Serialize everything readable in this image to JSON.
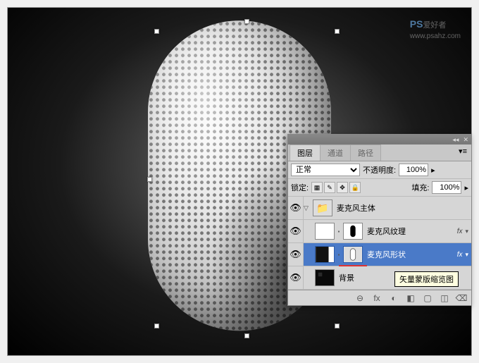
{
  "watermark": {
    "prefix": "PS",
    "suffix": "爱好者",
    "url": "www.psahz.com"
  },
  "panel": {
    "tabs": [
      {
        "label": "图层",
        "active": true
      },
      {
        "label": "通道",
        "active": false
      },
      {
        "label": "路径",
        "active": false
      }
    ],
    "blend": {
      "value": "正常"
    },
    "opacity": {
      "label": "不透明度:",
      "value": "100%"
    },
    "lock": {
      "label": "锁定:"
    },
    "fill": {
      "label": "填充:",
      "value": "100%"
    },
    "layers": [
      {
        "name": "麦克风主体",
        "type": "group",
        "visible": true
      },
      {
        "name": "麦克风纹理",
        "type": "layer",
        "visible": true,
        "fx": true
      },
      {
        "name": "麦克风形状",
        "type": "layer",
        "visible": true,
        "selected": true,
        "fx": true
      },
      {
        "name": "背景",
        "type": "bg",
        "visible": true
      }
    ],
    "tooltip": "矢量蒙版缩览图",
    "footer_icons": [
      "⊖",
      "fx",
      "◐",
      "◧",
      "▢",
      "◫",
      "⌫"
    ]
  }
}
